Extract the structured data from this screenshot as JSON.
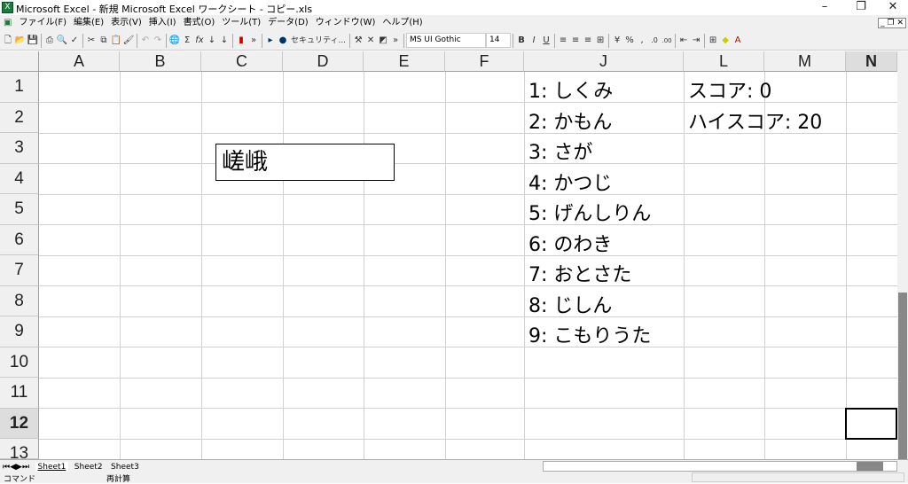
{
  "window": {
    "title": "Microsoft Excel - 新規 Microsoft Excel ワークシート - コピー.xls"
  },
  "menu": [
    "ファイル(F)",
    "編集(E)",
    "表示(V)",
    "挿入(I)",
    "書式(O)",
    "ツール(T)",
    "データ(D)",
    "ウィンドウ(W)",
    "ヘルプ(H)"
  ],
  "toolbar": {
    "security_label": "セキュリティ...",
    "font_name": "MS UI Gothic",
    "font_size": "14"
  },
  "columns": [
    "A",
    "B",
    "C",
    "D",
    "E",
    "F",
    "J",
    "L",
    "M",
    "N"
  ],
  "rows": [
    "1",
    "2",
    "3",
    "4",
    "5",
    "6",
    "7",
    "8",
    "9",
    "10",
    "11",
    "12",
    "13"
  ],
  "cells": {
    "J": [
      "1: しくみ",
      "2: かもん",
      "3: さが",
      "4: かつじ",
      "5: げんしりん",
      "6: のわき",
      "7: おとさた",
      "8: じしん",
      "9: こもりうた"
    ],
    "L1": "スコア: 0",
    "L2": "ハイスコア: 20"
  },
  "textbox": "嵯峨",
  "sheets": [
    "Sheet1",
    "Sheet2",
    "Sheet3"
  ],
  "status": {
    "mode": "コマンド",
    "calc": "再計算"
  }
}
